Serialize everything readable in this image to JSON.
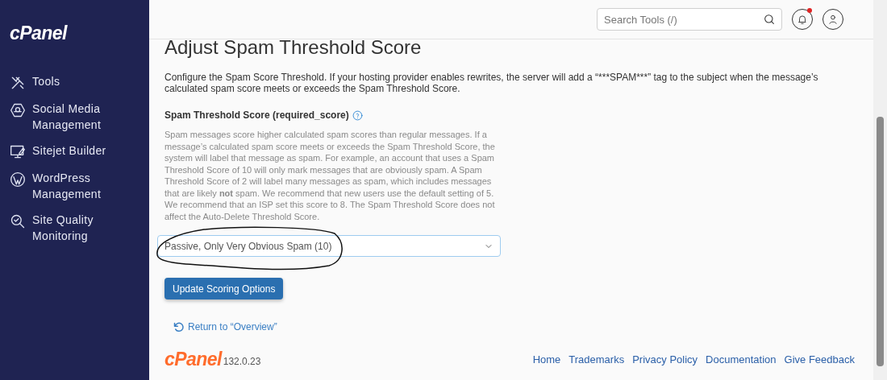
{
  "sidebar": {
    "logo": "cPanel",
    "items": [
      {
        "kind": "tools",
        "label": "Tools"
      },
      {
        "kind": "social",
        "label": "Social Media Management"
      },
      {
        "kind": "sitejet",
        "label": "Sitejet Builder"
      },
      {
        "kind": "wordpress",
        "label": "WordPress Management"
      },
      {
        "kind": "quality",
        "label": "Site Quality Monitoring"
      }
    ]
  },
  "header": {
    "search": {
      "placeholder": "Search Tools (/)"
    },
    "notifications": {
      "unread": true
    }
  },
  "page": {
    "title": "Adjust Spam Threshold Score",
    "intro": "Configure the Spam Score Threshold. If your hosting provider enables rewrites, the server will add a “***SPAM***” tag to the subject when the message’s calculated spam score meets or exceeds the Spam Threshold Score.",
    "field_label": "Spam Threshold Score (required_score)",
    "help_text": "Spam messages score higher calculated spam scores than regular messages. If a message’s calculated spam score meets or exceeds the Spam Threshold Score, the system will label that message as spam. For example, an account that uses a Spam Threshold Score of 10 will only mark messages that are obviously spam. A Spam Threshold Score of 2 will label many messages as spam, which includes messages that are likely **not** spam. We recommend that new users use the default setting of 5. We recommend that an ISP set this score to 8. The Spam Threshold Score does not affect the Auto-Delete Threshold Score.",
    "select_value": "Passive, Only Very Obvious Spam (10)",
    "submit_button": "Update Scoring Options",
    "return_link": "Return to “Overview”"
  },
  "footer": {
    "logo": "cPanel",
    "version": "132.0.23",
    "links": [
      "Home",
      "Trademarks",
      "Privacy Policy",
      "Documentation",
      "Give Feedback"
    ]
  }
}
